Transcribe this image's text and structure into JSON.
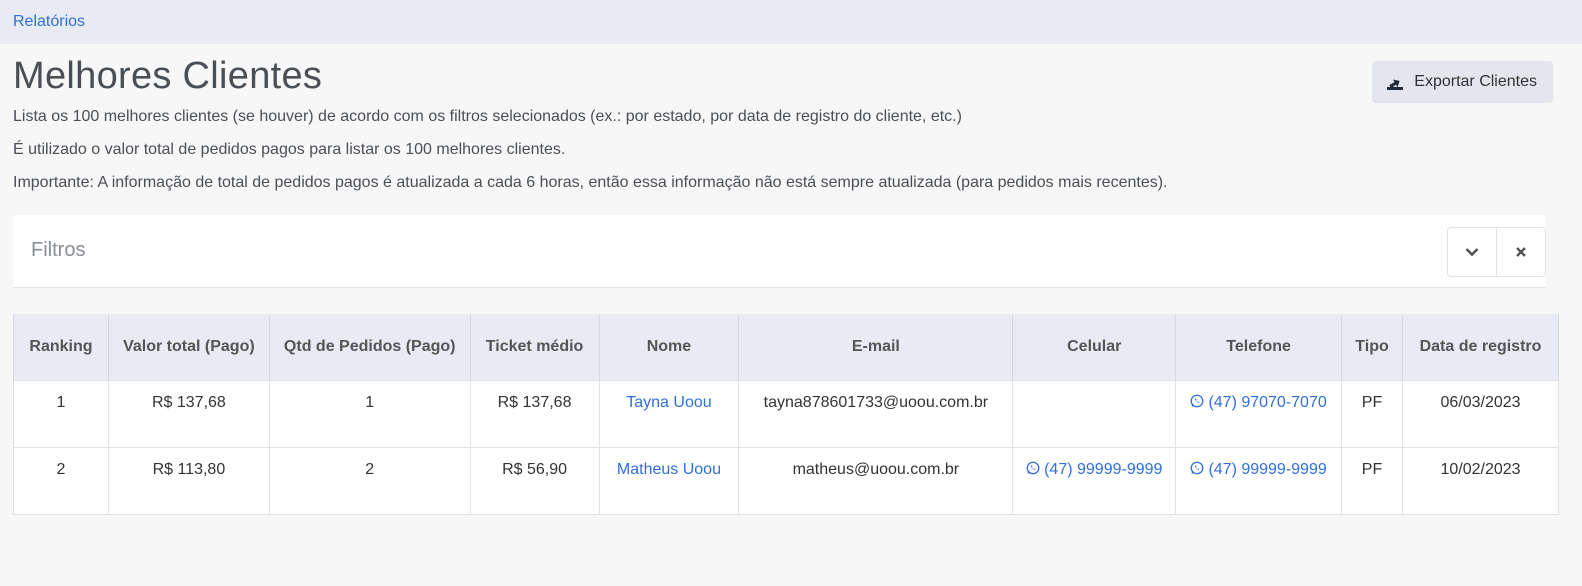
{
  "breadcrumb": {
    "label": "Relatórios"
  },
  "page": {
    "title": "Melhores Clientes",
    "export_label": "Exportar Clientes",
    "desc1": "Lista os 100 melhores clientes (se houver) de acordo com os filtros selecionados (ex.: por estado, por data de registro do cliente, etc.)",
    "desc2": "É utilizado o valor total de pedidos pagos para listar os 100 melhores clientes.",
    "desc3": "Importante: A informação de total de pedidos pagos é atualizada a cada 6 horas, então essa informação não está sempre atualizada (para pedidos mais recentes)."
  },
  "filters": {
    "title": "Filtros"
  },
  "table": {
    "headers": {
      "ranking": "Ranking",
      "valor_total": "Valor total (Pago)",
      "qtd_pedidos": "Qtd de Pedidos (Pago)",
      "ticket": "Ticket médio",
      "nome": "Nome",
      "email": "E-mail",
      "celular": "Celular",
      "telefone": "Telefone",
      "tipo": "Tipo",
      "data": "Data de registro"
    },
    "rows": [
      {
        "ranking": "1",
        "valor_total": "R$ 137,68",
        "qtd_pedidos": "1",
        "ticket": "R$ 137,68",
        "nome": "Tayna Uoou",
        "email": "tayna878601733@uoou.com.br",
        "celular": "",
        "telefone": "(47) 97070-7070",
        "tipo": "PF",
        "data": "06/03/2023"
      },
      {
        "ranking": "2",
        "valor_total": "R$ 113,80",
        "qtd_pedidos": "2",
        "ticket": "R$ 56,90",
        "nome": "Matheus Uoou",
        "email": "matheus@uoou.com.br",
        "celular": "(47) 99999-9999",
        "telefone": "(47) 99999-9999",
        "tipo": "PF",
        "data": "10/02/2023"
      }
    ]
  },
  "colors": {
    "link": "#2f6fdf",
    "topbar": "#e8ebf3",
    "header_bg": "#e8ebf3"
  },
  "icons": {
    "export": "export-icon",
    "whatsapp": "whatsapp-icon",
    "expand": "chevron-down-icon",
    "close": "close-icon"
  }
}
